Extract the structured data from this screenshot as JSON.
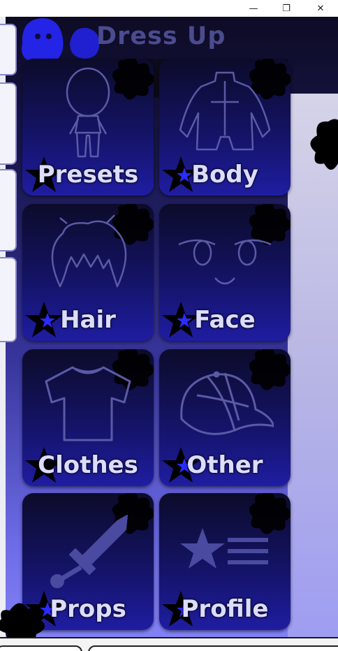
{
  "window": {
    "minimize_glyph": "—",
    "restore_glyph": "❐",
    "close_glyph": "✕"
  },
  "header": {
    "title": "Dress Up"
  },
  "menu": {
    "items": [
      {
        "label": "Presets",
        "icon": "chibi-figure-icon"
      },
      {
        "label": "Body",
        "icon": "bodysuit-icon"
      },
      {
        "label": "Hair",
        "icon": "hair-icon"
      },
      {
        "label": "Face",
        "icon": "face-icon"
      },
      {
        "label": "Clothes",
        "icon": "tshirt-icon"
      },
      {
        "label": "Other",
        "icon": "cap-icon"
      },
      {
        "label": "Props",
        "icon": "sword-icon"
      },
      {
        "label": "Profile",
        "icon": "star-list-icon"
      }
    ]
  },
  "colors": {
    "tile_top": "#0c0b2a",
    "tile_bottom": "#1f1da1",
    "icon_line": "#5a5aa6",
    "label": "#dcdcff",
    "star_accent": "#2b2bff"
  }
}
